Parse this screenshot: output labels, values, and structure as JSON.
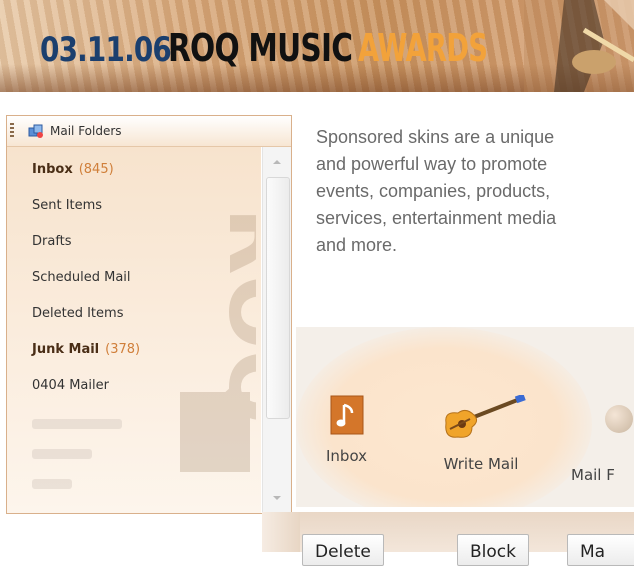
{
  "banner": {
    "date": "03.11.06",
    "roq": "ROQ MUSIC",
    "awards": "AWARDS"
  },
  "panel": {
    "title": "Mail Folders"
  },
  "folders": [
    {
      "name": "Inbox",
      "count": "(845)",
      "bold": true
    },
    {
      "name": "Sent Items",
      "count": "",
      "bold": false
    },
    {
      "name": "Drafts",
      "count": "",
      "bold": false
    },
    {
      "name": "Scheduled Mail",
      "count": "",
      "bold": false
    },
    {
      "name": "Deleted Items",
      "count": "",
      "bold": false
    },
    {
      "name": "Junk Mail",
      "count": "(378)",
      "bold": true
    },
    {
      "name": "0404 Mailer",
      "count": "",
      "bold": false
    }
  ],
  "description": {
    "lines": [
      "Sponsored skins are a unique",
      "and powerful way to promote",
      "events, companies, products,",
      "services, entertainment media",
      "and more."
    ]
  },
  "toolbar": {
    "inbox": "Inbox",
    "write_mail": "Write Mail",
    "mail_folders": "Mail F"
  },
  "actions": {
    "delete": "Delete",
    "block": "Block",
    "more": "Ma"
  },
  "colors": {
    "accent": "#d07f3a",
    "panel_border": "#d9b08b",
    "desc_text": "#6a6a6a"
  }
}
